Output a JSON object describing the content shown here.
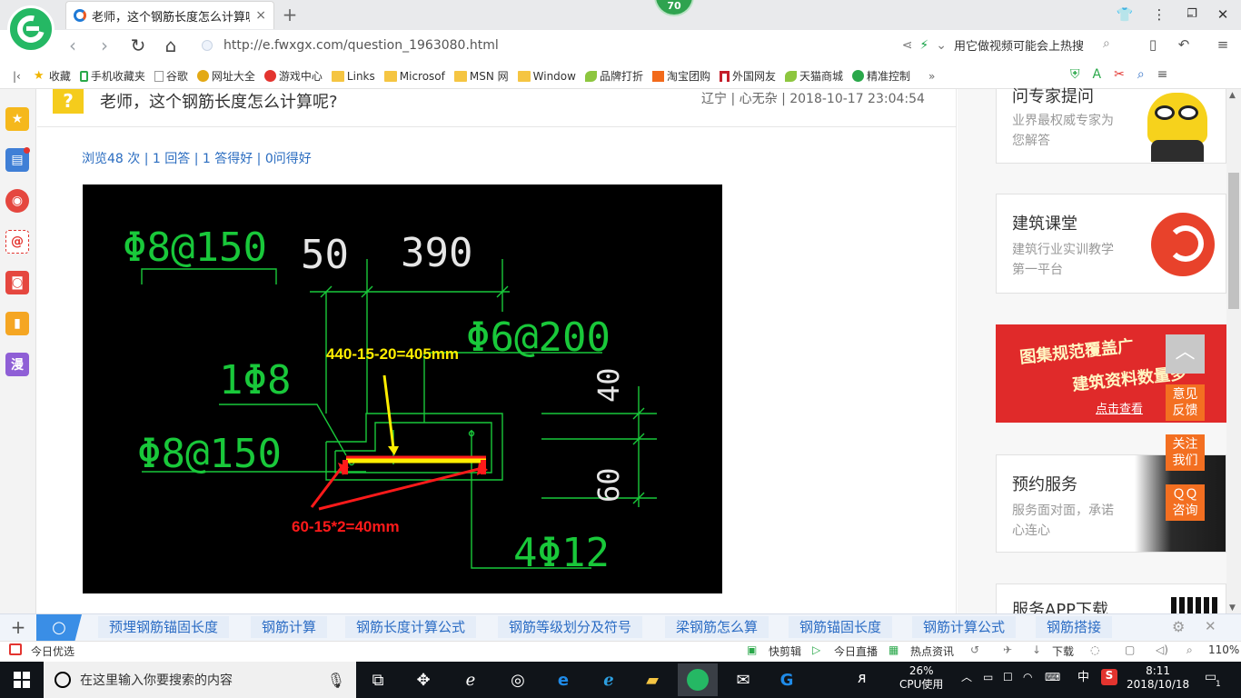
{
  "browser": {
    "tab_title": "老师，这个钢筋长度怎么计算呢?",
    "tab_close": "×",
    "new_tab": "+",
    "badge": "70",
    "url": "http://e.fwxgx.com/question_1963080.html",
    "search_hint": "用它做视频可能会上热搜",
    "zoom": "110%"
  },
  "bookmarks": [
    {
      "label": "收藏",
      "icon": "star-icon"
    },
    {
      "label": "手机收藏夹",
      "icon": "phone-icon"
    },
    {
      "label": "谷歌",
      "icon": "page-icon"
    },
    {
      "label": "网址大全",
      "icon": "globe-icon"
    },
    {
      "label": "游戏中心",
      "icon": "game-icon"
    },
    {
      "label": "Links",
      "icon": "folder-icon"
    },
    {
      "label": "Microsof",
      "icon": "folder-icon"
    },
    {
      "label": "MSN 网",
      "icon": "folder-icon"
    },
    {
      "label": "Window",
      "icon": "folder-icon"
    },
    {
      "label": "品牌打折",
      "icon": "leaf-icon"
    },
    {
      "label": "淘宝团购",
      "icon": "taobao-icon"
    },
    {
      "label": "外国网友",
      "icon": "gate-icon"
    },
    {
      "label": "天猫商城",
      "icon": "leaf-icon"
    },
    {
      "label": "精准控制",
      "icon": "chat-icon"
    }
  ],
  "sidebar_manga": "漫",
  "question": {
    "icon": "?",
    "title": "老师，这个钢筋长度怎么计算呢?",
    "meta": "辽宁 | 心无杂 | 2018-10-17 23:04:54",
    "stats": "浏览48 次 | 1 回答 | 1 答得好 | 0问得好"
  },
  "cad": {
    "t1": "Φ8@150",
    "t2": "50",
    "t3": "390",
    "t4": "Φ6@200",
    "t5": "1Φ8",
    "t6": "Φ8@150",
    "t7": "40",
    "t8": "60",
    "t9": "4Φ12",
    "yellow_note": "440-15-20=405mm",
    "red_note": "60-15*2=40mm"
  },
  "right": {
    "card1_title": "问专家提问",
    "card1_sub": "业界最权威专家为您解答",
    "card2_title": "建筑课堂",
    "card2_sub": "建筑行业实训教学第一平台",
    "banner_line1": "图集规范覆盖广",
    "banner_line2": "建筑资料数量多",
    "banner_link": "点击查看",
    "card3_title": "预约服务",
    "card3_sub": "服务面对面，承诺心连心",
    "card4_title": "服务APP下载",
    "float_top": "︿",
    "float1": "意见反馈",
    "float2": "关注我们",
    "float3": "ＱＱ咨询"
  },
  "tags": [
    "预埋钢筋锚固长度",
    "钢筋计算",
    "钢筋长度计算公式",
    "钢筋等级划分及符号",
    "梁钢筋怎么算",
    "钢筋锚固长度",
    "钢筋计算公式",
    "钢筋搭接"
  ],
  "statusbar": {
    "left": "今日优选",
    "items": [
      "快剪辑",
      "今日直播",
      "热点资讯",
      "下载"
    ],
    "zoom": "110%"
  },
  "taskbar": {
    "search_placeholder": "在这里输入你要搜索的内容",
    "cpu_percent": "26%",
    "cpu_label": "CPU使用",
    "ime": "中",
    "time": "8:11",
    "date": "2018/10/18",
    "notif": "1"
  },
  "colors": {
    "accent_green": "#25b864",
    "link_blue": "#2a6cc0",
    "cad_green": "#19c83a",
    "annotation_yellow": "#ffee00",
    "annotation_red": "#ff1a1a",
    "float_orange": "#f36f21"
  }
}
